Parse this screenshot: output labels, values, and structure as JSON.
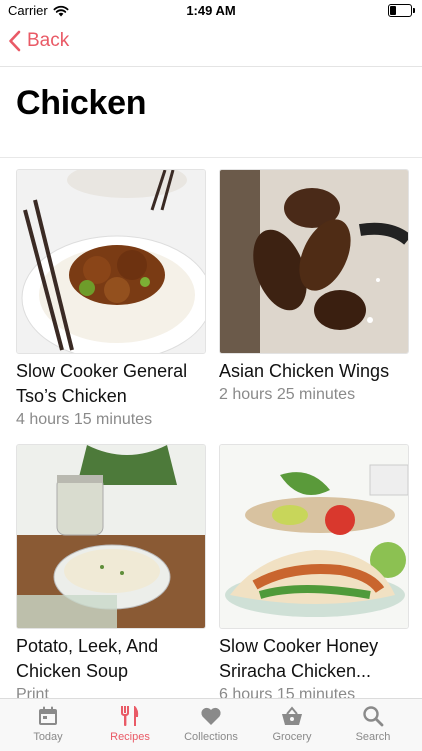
{
  "status": {
    "carrier": "Carrier",
    "time": "1:49 AM"
  },
  "nav": {
    "back_label": "Back"
  },
  "page": {
    "title": "Chicken"
  },
  "recipes": [
    {
      "name": "Slow Cooker General Tso’s Chicken",
      "meta": "4 hours 15 minutes"
    },
    {
      "name": "Asian Chicken Wings",
      "meta": "2 hours 25 minutes"
    },
    {
      "name": "Potato, Leek, And Chicken Soup",
      "meta": "Print"
    },
    {
      "name": "Slow Cooker Honey Sriracha Chicken...",
      "meta": "6 hours 15 minutes"
    }
  ],
  "tabs": [
    {
      "label": "Today",
      "icon": "calendar-icon"
    },
    {
      "label": "Recipes",
      "icon": "fork-knife-icon"
    },
    {
      "label": "Collections",
      "icon": "heart-icon"
    },
    {
      "label": "Grocery",
      "icon": "basket-icon"
    },
    {
      "label": "Search",
      "icon": "search-icon"
    }
  ],
  "colors": {
    "accent": "#e95a66",
    "inactive": "#8a8a8a"
  }
}
